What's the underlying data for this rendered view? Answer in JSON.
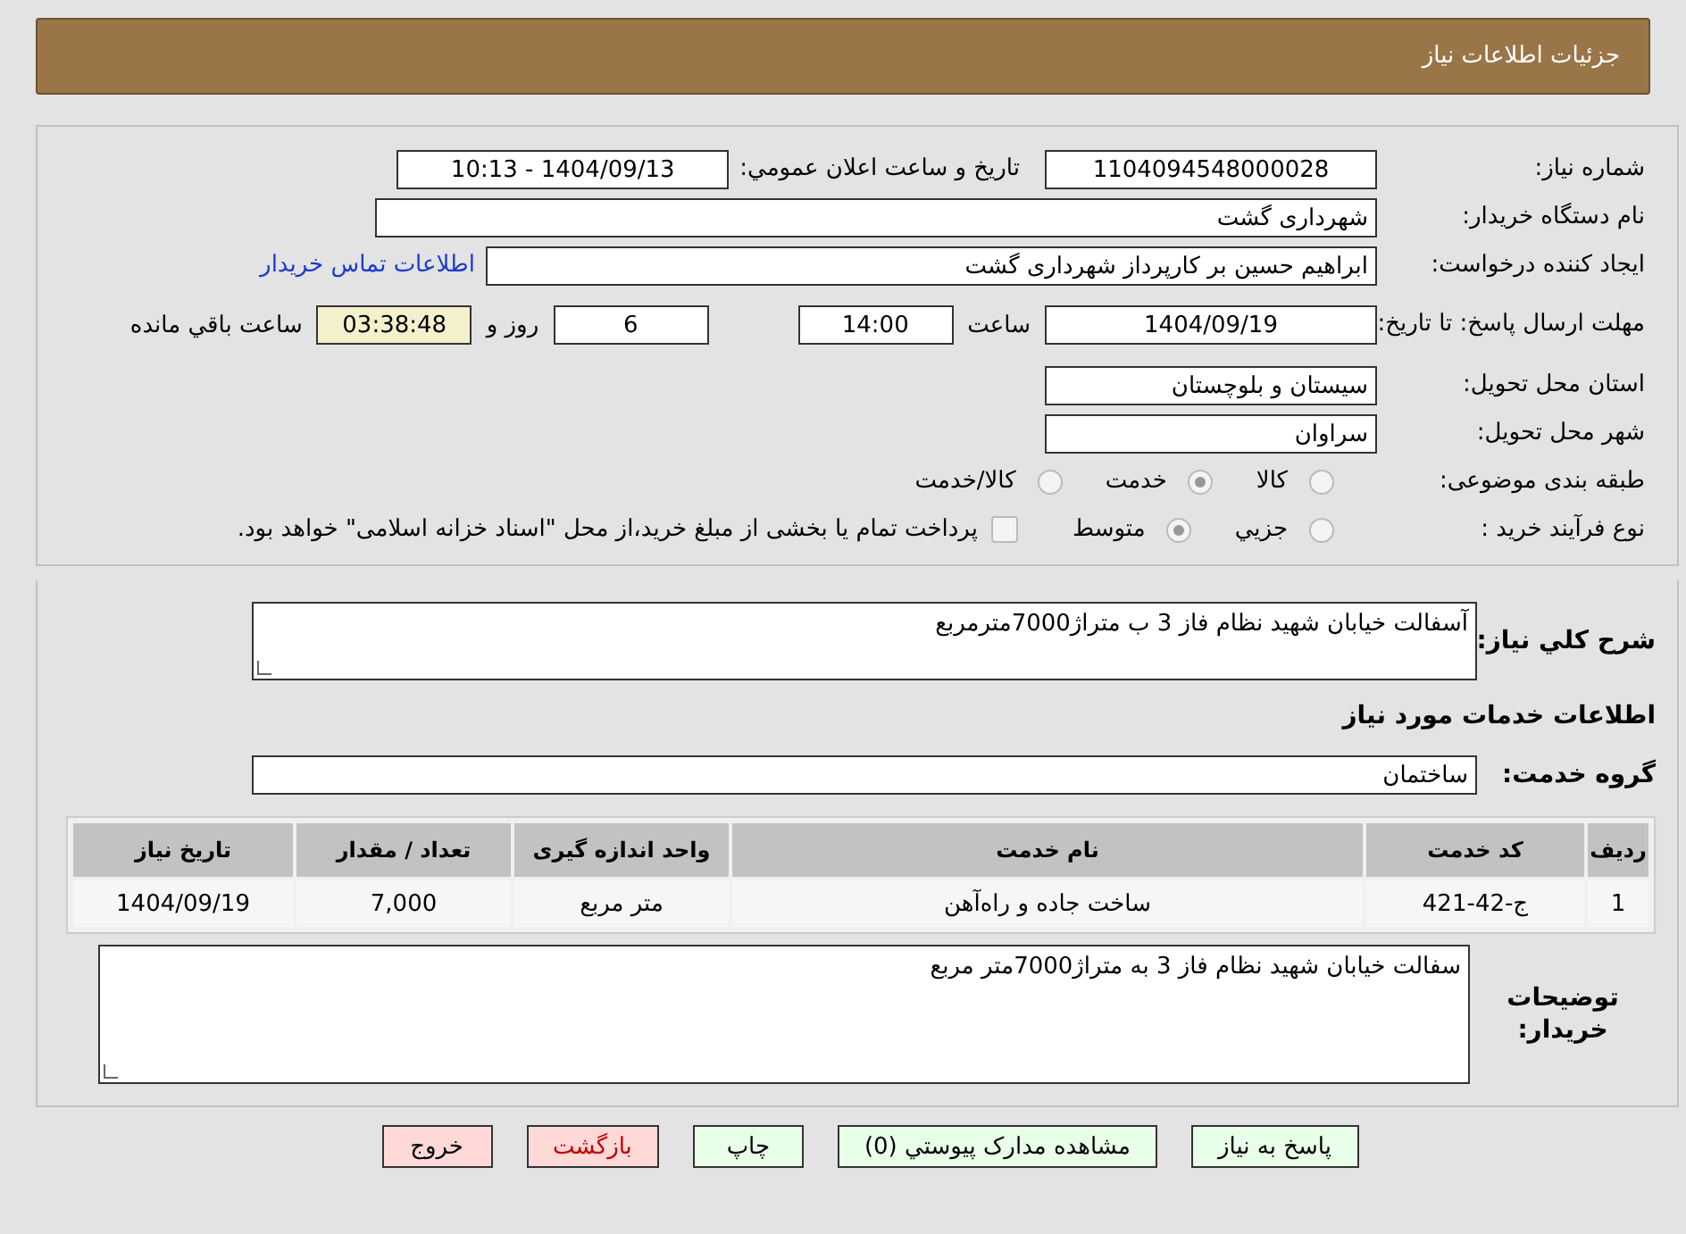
{
  "header": {
    "title": "جزئیات اطلاعات نیاز"
  },
  "need_number": {
    "label": "شماره نیاز:",
    "value": "1104094548000028"
  },
  "announce": {
    "label": "تاریخ و ساعت اعلان عمومي:",
    "value": "1404/09/13 - 10:13"
  },
  "buyer": {
    "label": "نام دستگاه خریدار:",
    "value": "شهرداری گشت"
  },
  "creator": {
    "label": "ایجاد کننده درخواست:",
    "value": "ابراهیم حسین بر کارپرداز شهرداری گشت",
    "link": "اطلاعات تماس خریدار"
  },
  "deadline": {
    "label": "مهلت ارسال پاسخ: تا تاریخ:",
    "date": "1404/09/19",
    "time_label": "ساعت",
    "time": "14:00",
    "days": "6",
    "days_label": "روز و",
    "remaining": "03:38:48",
    "remaining_label": "ساعت باقي مانده"
  },
  "province": {
    "label": "استان محل تحویل:",
    "value": "سیستان و بلوچستان"
  },
  "city": {
    "label": "شهر محل تحویل:",
    "value": "سراوان"
  },
  "category": {
    "label": "طبقه بندی موضوعی:",
    "options": [
      {
        "label": "کالا",
        "selected": false
      },
      {
        "label": "خدمت",
        "selected": true
      },
      {
        "label": "کالا/خدمت",
        "selected": false
      }
    ]
  },
  "process": {
    "label": "نوع فرآیند خرید :",
    "options": [
      {
        "label": "جزيي",
        "selected": false
      },
      {
        "label": "متوسط",
        "selected": true
      }
    ],
    "treasury": {
      "checked": false,
      "text": "پرداخت تمام یا بخشی از مبلغ خرید،از محل \"اسناد خزانه اسلامی\" خواهد بود."
    }
  },
  "description": {
    "label": "شرح كلي نياز:",
    "value": "آسفالت خیابان شهید نظام فاز 3 ب متراژ7000مترمربع"
  },
  "services_heading": "اطلاعات خدمات مورد نیاز",
  "service_group": {
    "label": "گروه خدمت:",
    "value": "ساختمان"
  },
  "table": {
    "columns": [
      "ردیف",
      "کد خدمت",
      "نام خدمت",
      "واحد اندازه گیری",
      "تعداد / مقدار",
      "تاریخ نیاز"
    ],
    "rows": [
      [
        "1",
        "ج-42-421",
        "ساخت جاده و راه‌آهن",
        "متر مربع",
        "7,000",
        "1404/09/19"
      ]
    ]
  },
  "buyer_notes": {
    "label": "توضیحات خریدار:",
    "value": "سفالت خیابان شهید نظام فاز 3 به متراژ7000متر مربع"
  },
  "buttons": [
    {
      "label": "پاسخ به نیاز",
      "kind": "normal"
    },
    {
      "label": "مشاهده مدارک پیوستي (0)",
      "kind": "normal"
    },
    {
      "label": "چاپ",
      "kind": "normal"
    },
    {
      "label": "بازگشت",
      "kind": "back"
    },
    {
      "label": "خروج",
      "kind": "exit"
    }
  ]
}
